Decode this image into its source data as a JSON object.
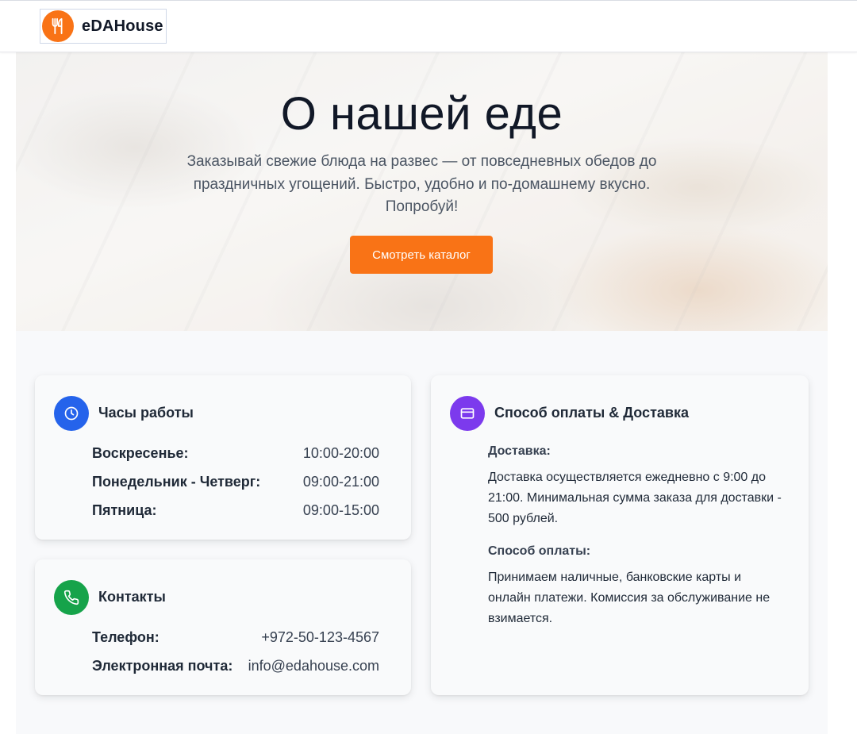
{
  "header": {
    "brand": "eDAHouse",
    "logo_icon": "utensils-icon",
    "accent": "#f97316"
  },
  "hero": {
    "title": "О нашей еде",
    "subtitle": "Заказывай свежие блюда на развес — от повседневных обедов до праздничных угощений. Быстро, удобно и по-домашнему вкусно. Попробуй!",
    "button_label": "Смотреть каталог",
    "background_image": "food-display-photo"
  },
  "hours": {
    "title": "Часы работы",
    "icon": "clock-icon",
    "icon_color": "#2563eb",
    "rows": [
      {
        "label": "Воскресенье:",
        "value": "10:00-20:00"
      },
      {
        "label": "Понедельник - Четверг:",
        "value": "09:00-21:00"
      },
      {
        "label": "Пятница:",
        "value": "09:00-15:00"
      }
    ]
  },
  "contacts": {
    "title": "Контакты",
    "icon": "phone-icon",
    "icon_color": "#16a34a",
    "rows": [
      {
        "label": "Телефон:",
        "value": "+972-50-123-4567"
      },
      {
        "label": "Электронная почта:",
        "value": "info@edahouse.com"
      }
    ]
  },
  "payment": {
    "title": "Способ оплаты & Доставка",
    "icon": "credit-card-icon",
    "icon_color": "#7c3aed",
    "delivery_heading": "Доставка:",
    "delivery_text": "Доставка осуществляется ежедневно с 9:00 до 21:00. Минимальная сумма заказа для доставки - 500 рублей.",
    "payment_heading": "Способ оплаты:",
    "payment_text": "Принимаем наличные, банковские карты и онлайн платежи. Комиссия за обслуживание не взимается."
  }
}
